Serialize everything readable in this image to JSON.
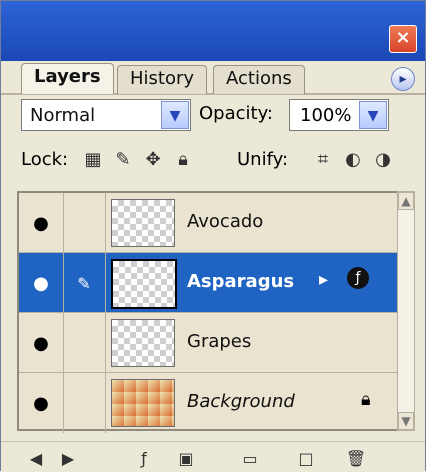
{
  "tabs": [
    "Layers",
    "History",
    "Actions"
  ],
  "blend_mode": "Normal",
  "opacity_label": "Opacity:",
  "opacity_value": "100%",
  "lock_label": "Lock:",
  "unify_label": "Unify:",
  "layers": [
    {
      "name": "Avocado",
      "visible": true,
      "selected": false
    },
    {
      "name": "Asparagus",
      "visible": true,
      "selected": true
    },
    {
      "name": "Grapes",
      "visible": true,
      "selected": false
    },
    {
      "name": "Background",
      "visible": true,
      "selected": false,
      "locked": true
    }
  ]
}
